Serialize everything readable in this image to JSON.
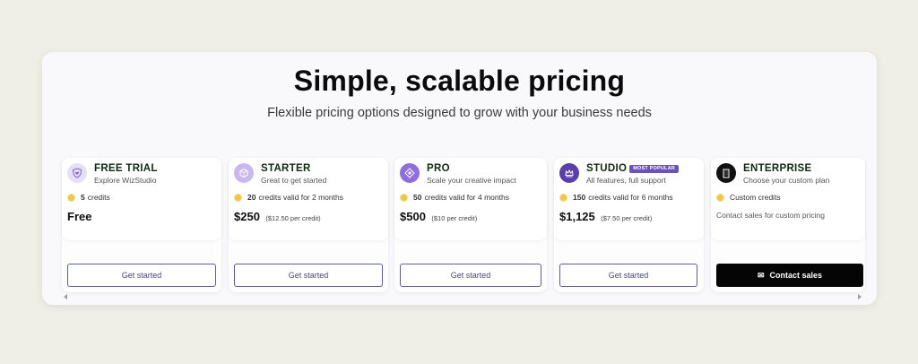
{
  "header": {
    "title": "Simple, scalable pricing",
    "subtitle": "Flexible pricing options designed to grow with your business needs"
  },
  "plans": [
    {
      "name": "FREE TRIAL",
      "description": "Explore WizStudio",
      "credits_count": "5",
      "credits_text": "credits",
      "price": "Free",
      "per_credit": "",
      "button": "Get started",
      "icon": "shield-heart-icon",
      "icon_bg": "#e6e0f7"
    },
    {
      "name": "STARTER",
      "description": "Great to get started",
      "credits_count": "20",
      "credits_text": "credits valid for 2 months",
      "price": "$250",
      "per_credit": "($12.50 per credit)",
      "button": "Get started",
      "icon": "cube-icon",
      "icon_bg": "#c9b8f0"
    },
    {
      "name": "PRO",
      "description": "Scale your creative impact",
      "credits_count": "50",
      "credits_text": "credits valid for 4 months",
      "price": "$500",
      "per_credit": "($10 per credit)",
      "button": "Get started",
      "icon": "diamond-icon",
      "icon_bg": "#8f6fe0"
    },
    {
      "name": "STUDIO",
      "badge": "MOST POPULAR",
      "description": "All features, full support",
      "credits_count": "150",
      "credits_text": "credits valid for 6 months",
      "price": "$1,125",
      "per_credit": "($7.50 per credit)",
      "button": "Get started",
      "icon": "crown-icon",
      "icon_bg": "#5a3fa8"
    },
    {
      "name": "ENTERPRISE",
      "description": "Choose your custom plan",
      "credits_count": "",
      "credits_text": "Custom credits",
      "note": "Contact sales for custom pricing",
      "button": "Contact sales",
      "icon": "building-icon",
      "icon_bg": "#111111"
    }
  ],
  "colors": {
    "page_bg": "#efefe7",
    "panel_bg": "#f9f8fb",
    "coin": "#f2c447",
    "button_border": "#5b5f8c",
    "badge": "#6a52b8",
    "dark_button": "#050505"
  }
}
